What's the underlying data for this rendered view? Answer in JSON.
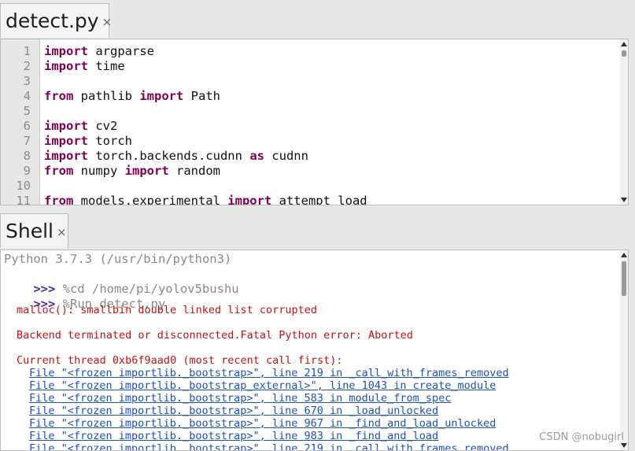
{
  "editor": {
    "tab_title": "detect.py",
    "close_glyph": "×",
    "lines": [
      {
        "n": "1",
        "kw1": "import",
        "rest1": " argparse",
        "kw2": "",
        "rest2": ""
      },
      {
        "n": "2",
        "kw1": "import",
        "rest1": " time",
        "kw2": "",
        "rest2": ""
      },
      {
        "n": "3",
        "kw1": "",
        "rest1": "",
        "kw2": "",
        "rest2": ""
      },
      {
        "n": "4",
        "kw1": "from",
        "rest1": " pathlib ",
        "kw2": "import",
        "rest2": " Path"
      },
      {
        "n": "5",
        "kw1": "",
        "rest1": "",
        "kw2": "",
        "rest2": ""
      },
      {
        "n": "6",
        "kw1": "import",
        "rest1": " cv2",
        "kw2": "",
        "rest2": ""
      },
      {
        "n": "7",
        "kw1": "import",
        "rest1": " torch",
        "kw2": "",
        "rest2": ""
      },
      {
        "n": "8",
        "kw1": "import",
        "rest1": " torch.backends.cudnn ",
        "kw2": "as",
        "rest2": " cudnn"
      },
      {
        "n": "9",
        "kw1": "from",
        "rest1": " numpy ",
        "kw2": "import",
        "rest2": " random"
      },
      {
        "n": "10",
        "kw1": "",
        "rest1": "",
        "kw2": "",
        "rest2": ""
      },
      {
        "n": "11",
        "kw1": "from",
        "rest1": " models.experimental ",
        "kw2": "import",
        "rest2": " attempt_load"
      }
    ]
  },
  "shell": {
    "tab_title": "Shell",
    "close_glyph": "×",
    "banner": "Python 3.7.3 (/usr/bin/python3)",
    "prompt": ">>>",
    "commands": [
      " %cd /home/pi/yolov5bushu",
      " %Run detect.py"
    ],
    "errors": [
      "malloc(): smallbin double linked list corrupted",
      "Backend terminated or disconnected.Fatal Python error: Aborted",
      "Current thread 0xb6f9aad0 (most recent call first):"
    ],
    "trace": [
      "File \"<frozen importlib._bootstrap>\", line 219 in _call_with_frames_removed",
      "File \"<frozen importlib._bootstrap_external>\", line 1043 in create_module",
      "File \"<frozen importlib._bootstrap>\", line 583 in module_from_spec",
      "File \"<frozen importlib._bootstrap>\", line 670 in _load_unlocked",
      "File \"<frozen importlib._bootstrap>\", line 967 in _find_and_load_unlocked",
      "File \"<frozen importlib._bootstrap>\", line 983 in _find_and_load",
      "File \"<frozen importlib._bootstrap>\", line 219 in _call_with_frames_removed"
    ]
  },
  "watermark": "CSDN @nobugirl"
}
